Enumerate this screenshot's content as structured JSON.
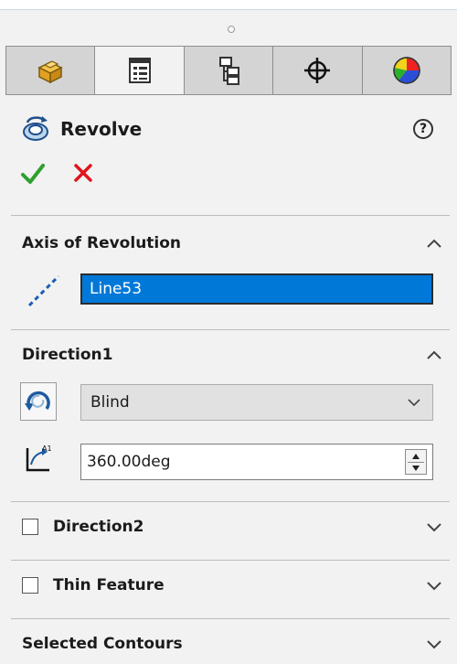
{
  "panel": {
    "title": "Revolve",
    "help_label": "?"
  },
  "tabs": [
    {
      "name": "feature-manager",
      "icon": "featuremanager-icon"
    },
    {
      "name": "property-manager",
      "icon": "propertymanager-icon"
    },
    {
      "name": "configuration-manager",
      "icon": "configurationmanager-icon"
    },
    {
      "name": "dimxpert-manager",
      "icon": "crosshair-icon"
    },
    {
      "name": "display-manager",
      "icon": "display-pie-icon"
    }
  ],
  "axis_of_revolution": {
    "title": "Axis of Revolution",
    "value": "Line53"
  },
  "direction1": {
    "title": "Direction1",
    "end_condition": "Blind",
    "angle": "360.00deg"
  },
  "direction2": {
    "title": "Direction2"
  },
  "thin_feature": {
    "title": "Thin Feature"
  },
  "selected_contours": {
    "title": "Selected Contours"
  },
  "colors": {
    "selection": "#0078d7",
    "ok": "#2ea02e",
    "cancel": "#e0141b"
  }
}
